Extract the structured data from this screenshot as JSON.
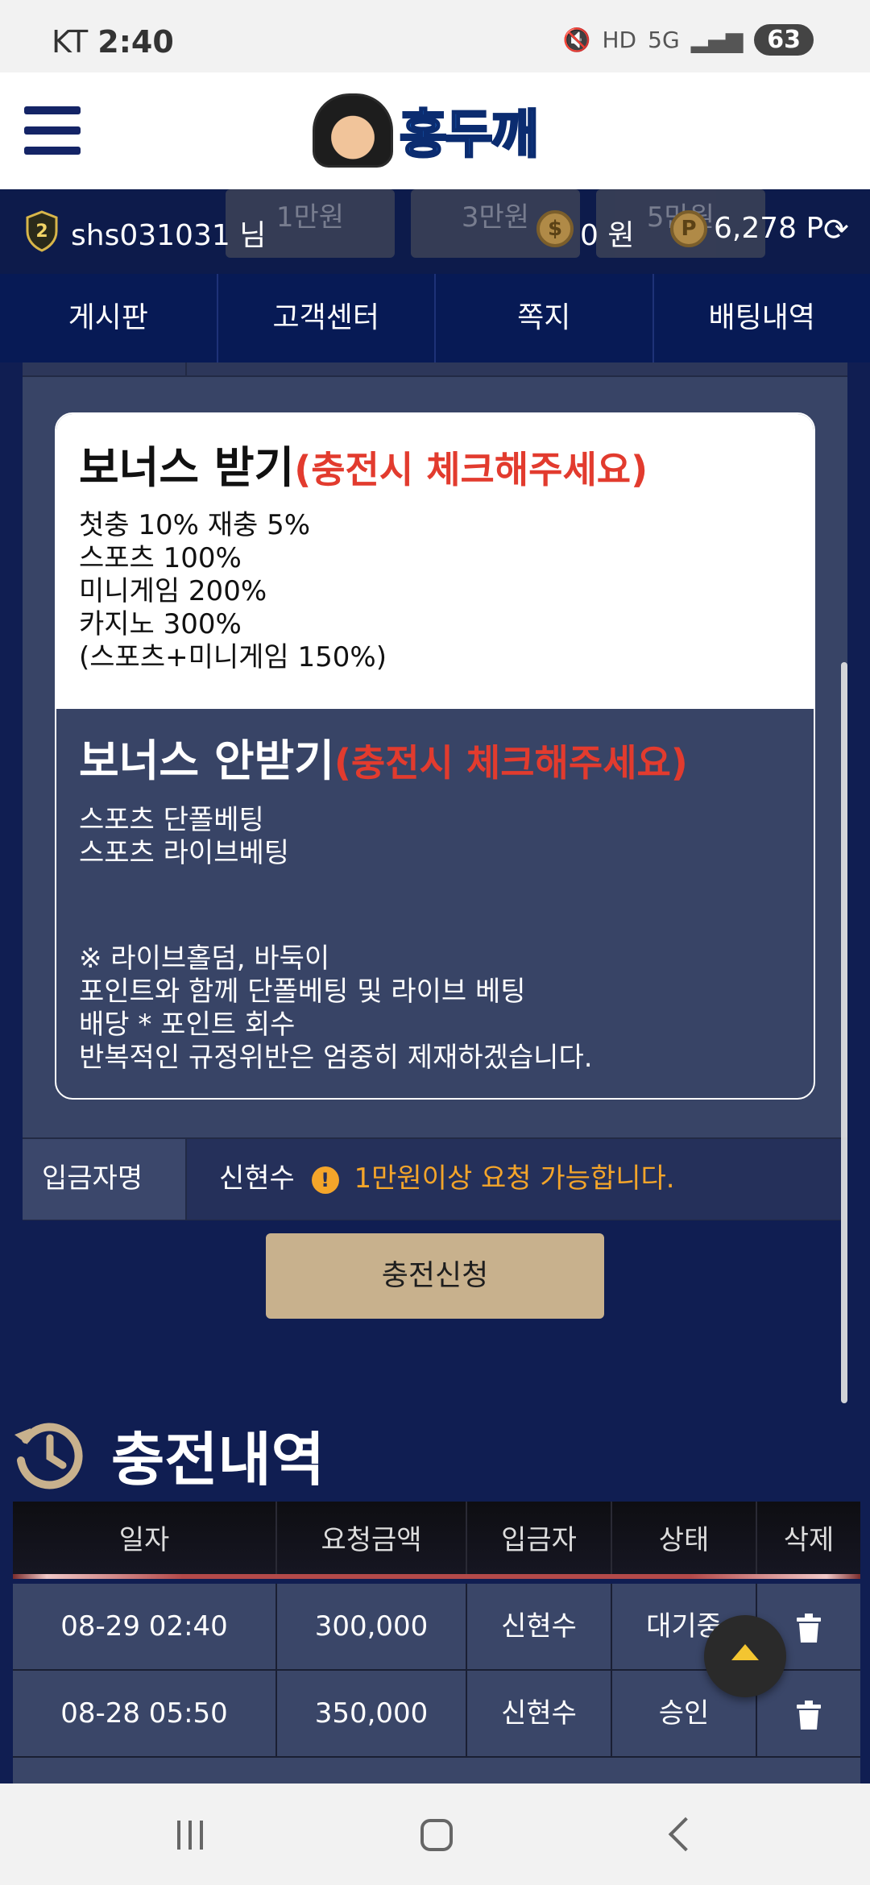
{
  "status_bar": {
    "carrier": "KT",
    "time": "2:40",
    "battery": "63"
  },
  "header": {
    "brand": "홍두깨"
  },
  "user_bar": {
    "ghost_buttons": [
      "1만원",
      "3만원",
      "5만원"
    ],
    "username": "shs031031 님",
    "money": "0 원",
    "points": "6,278 P"
  },
  "nav": {
    "items": [
      "게시판",
      "고객센터",
      "쪽지",
      "배팅내역"
    ]
  },
  "bonus": {
    "yes_title": "보너스 받기",
    "yes_note": "(충전시 체크해주세요)",
    "yes_lines": [
      "첫충 10% 재충 5%",
      "스포츠 100%",
      "미니게임 200%",
      "카지노 300%",
      "(스포츠+미니게임 150%)"
    ],
    "no_title": "보너스 안받기",
    "no_note": "(충전시 체크해주세요)",
    "no_lines": [
      "스포츠 단폴베팅",
      "스포츠 라이브베팅"
    ],
    "no_warning": [
      "※ 라이브홀덤, 바둑이",
      "포인트와 함께 단폴베팅 및 라이브 베팅",
      "배당 * 포인트 회수",
      "반복적인 규정위반은 엄중히 제재하겠습니다."
    ]
  },
  "depositor": {
    "label": "입금자명",
    "value": "신현수",
    "notice": "1만원이상 요청 가능합니다."
  },
  "charge_button": "충전신청",
  "history": {
    "title": "충전내역",
    "columns": [
      "일자",
      "요청금액",
      "입금자",
      "상태",
      "삭제"
    ],
    "rows": [
      {
        "date": "08-29 02:40",
        "amount": "300,000",
        "depositor": "신현수",
        "status": "대기중"
      },
      {
        "date": "08-28 05:50",
        "amount": "350,000",
        "depositor": "신현수",
        "status": "승인"
      }
    ]
  },
  "icons": {
    "money": "$",
    "points": "P",
    "level": "2",
    "info": "!"
  }
}
